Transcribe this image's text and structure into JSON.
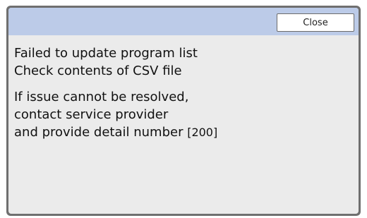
{
  "dialog": {
    "close_label": "Close",
    "message": {
      "line1": "Failed to update program list",
      "line2": "Check contents of CSV file",
      "line3": "If issue cannot be resolved,",
      "line4": "contact service provider",
      "line5_text": "and provide detail number ",
      "detail_code": "[200]"
    }
  },
  "colors": {
    "titlebar": "#bccbe8",
    "dialog_background": "#ebebeb",
    "frame": "#6f6f6f"
  }
}
